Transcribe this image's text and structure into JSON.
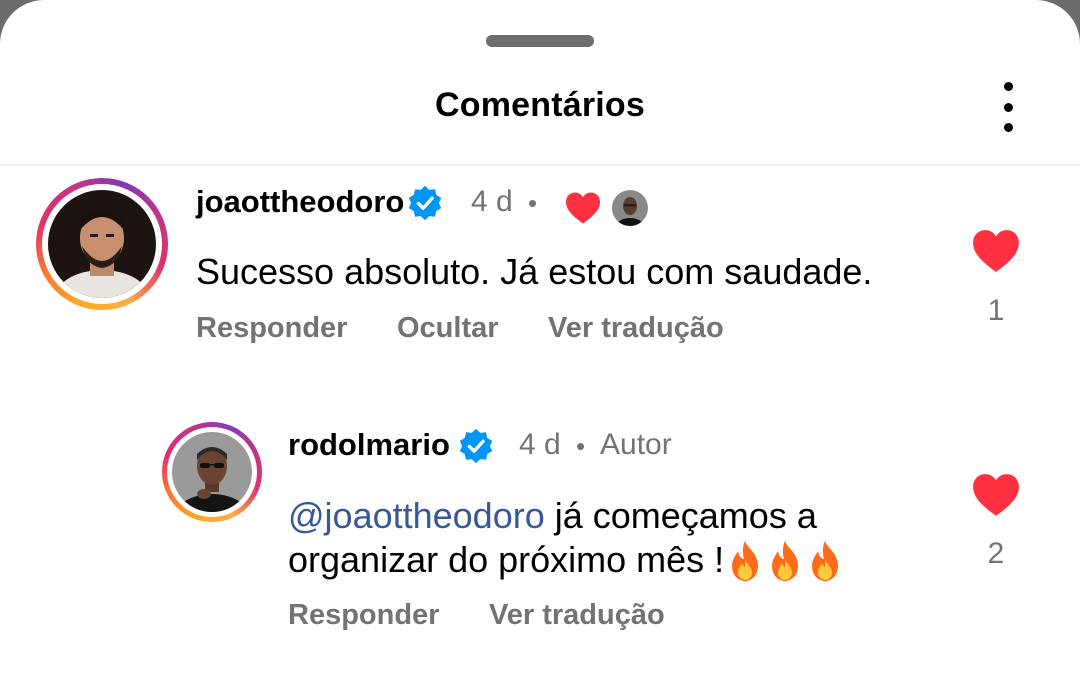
{
  "header": {
    "title": "Comentários",
    "more_icon": "more-vertical-icon"
  },
  "comments": [
    {
      "username": "joaottheodoro",
      "verified": true,
      "time": "4 d",
      "liked_by_author": true,
      "text": "Sucesso absoluto. Já estou com saudade.",
      "actions": [
        "Responder",
        "Ocultar",
        "Ver tradução"
      ],
      "likes": "1"
    },
    {
      "username": "rodolmario",
      "verified": true,
      "time": "4 d",
      "author_tag": "Autor",
      "mention": "@joaottheodoro",
      "text_line1": " já começamos a",
      "text_line2": "organizar do próximo mês !",
      "emoji": "🔥🔥🔥",
      "actions": [
        "Responder",
        "Ver tradução"
      ],
      "likes": "2"
    }
  ],
  "colors": {
    "like_red": "#ff3040",
    "verified_blue": "#0095f6",
    "meta_gray": "#737373",
    "mention_blue": "#385898"
  }
}
